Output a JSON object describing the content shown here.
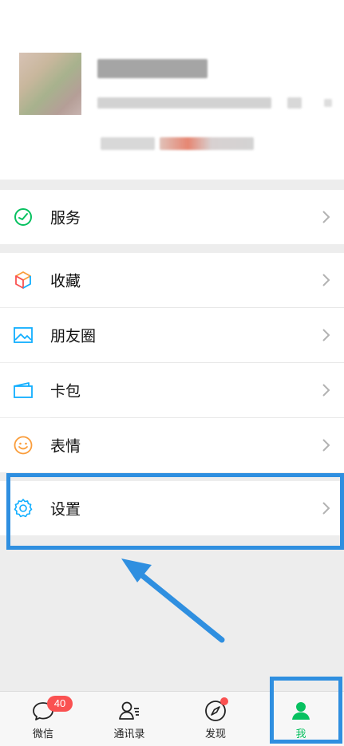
{
  "menu": {
    "services": "服务",
    "favorites": "收藏",
    "moments": "朋友圈",
    "cards": "卡包",
    "stickers": "表情",
    "settings": "设置"
  },
  "tabs": [
    {
      "label": "微信",
      "badge": "40",
      "icon": "chat-icon"
    },
    {
      "label": "通讯录",
      "icon": "contacts-icon"
    },
    {
      "label": "发现",
      "icon": "discover-icon"
    },
    {
      "label": "我",
      "icon": "me-icon"
    }
  ],
  "colors": {
    "accent": "#07c160",
    "highlight": "#2f8fe0",
    "badge": "#fa5151"
  }
}
